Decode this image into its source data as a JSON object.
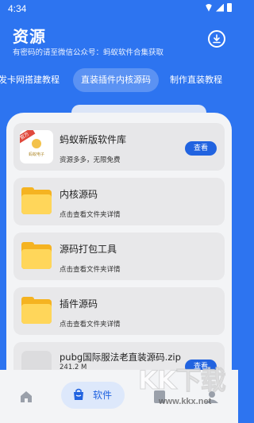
{
  "status": {
    "time": "4:34"
  },
  "header": {
    "title": "资源",
    "subtitle": "有密码的请至微信公众号：蚂蚁软件合集获取"
  },
  "tabs": [
    {
      "label": "发卡网搭建教程"
    },
    {
      "label": "直装插件内核源码"
    },
    {
      "label": "制作直装教程"
    }
  ],
  "items": [
    {
      "title": "蚂蚁新版软件库",
      "desc": "资源多多，无限免费",
      "badge": "官方",
      "logo_text": "蚂蚁电子",
      "action": "查看"
    },
    {
      "title": "内核源码",
      "desc": "点击查看文件夹详情"
    },
    {
      "title": "源码打包工具",
      "desc": "点击查看文件夹详情"
    },
    {
      "title": "插件源码",
      "desc": "点击查看文件夹详情"
    },
    {
      "title": "pubg国际服法老直装源码.zip",
      "desc": "241.2 M",
      "action": "查看"
    }
  ],
  "nav": {
    "software_label": "软件"
  },
  "watermark": {
    "main": "KK下载",
    "url": "www.kkx.net"
  },
  "colors": {
    "primary": "#2d74f0",
    "button": "#2163e0",
    "folder": "#ffd65a"
  }
}
